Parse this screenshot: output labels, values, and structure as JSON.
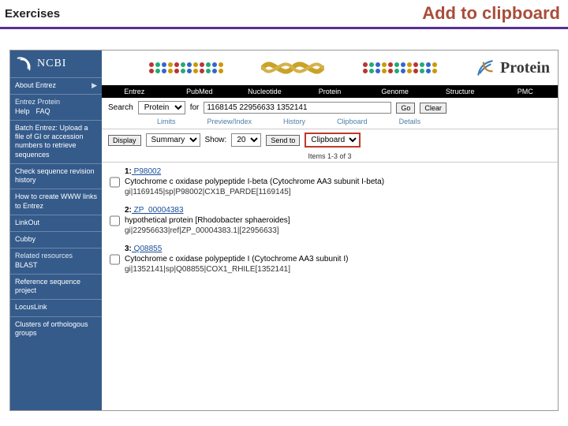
{
  "slide": {
    "left": "Exercises",
    "right": "Add to clipboard"
  },
  "sidebar": {
    "brand": "NCBI",
    "about": "About Entrez",
    "section_title": "Entrez Protein",
    "help": "Help",
    "faq": "FAQ",
    "batch": "Batch Entrez: Upload a file of GI or accession numbers to retrieve sequences",
    "revision": "Check sequence revision history",
    "howto": "How to create WWW links to Entrez",
    "linkout": "LinkOut",
    "cubby": "Cubby",
    "related": "Related resources",
    "blast": "BLAST",
    "ref": "Reference sequence project",
    "locuslink": "LocusLink",
    "cog": "Clusters of orthologous groups"
  },
  "tabs": [
    "Entrez",
    "PubMed",
    "Nucleotide",
    "Protein",
    "Genome",
    "Structure",
    "PMC"
  ],
  "search": {
    "label": "Search",
    "db": "Protein",
    "for": "for",
    "query": "1168145 22956633 1352141",
    "go": "Go",
    "clear": "Clear"
  },
  "sublinks": [
    "Limits",
    "Preview/Index",
    "History",
    "Clipboard",
    "Details"
  ],
  "display": {
    "label": "Display",
    "format": "Summary",
    "show_label": "Show:",
    "show": "20",
    "send": "Send to",
    "sendto": "Clipboard"
  },
  "items_text": "Items 1-3 of 3",
  "results": [
    {
      "n": "1:",
      "acc": "P98002",
      "title": "Cytochrome c oxidase polypeptide I-beta (Cytochrome AA3 subunit I-beta)",
      "gi": "gi|1169145|sp|P98002|CX1B_PARDE[1169145]"
    },
    {
      "n": "2:",
      "acc": "ZP_00004383",
      "title": "hypothetical protein [Rhodobacter sphaeroides]",
      "gi": "gi|22956633|ref|ZP_00004383.1|[22956633]"
    },
    {
      "n": "3:",
      "acc": "Q08855",
      "title": "Cytochrome c oxidase polypeptide I (Cytochrome AA3 subunit I)",
      "gi": "gi|1352141|sp|Q08855|COX1_RHILE[1352141]"
    }
  ],
  "banner": {
    "title": "Protein"
  },
  "bead_colors": [
    "#b33",
    "#2a7",
    "#36c",
    "#c90",
    "#b33",
    "#2a7",
    "#36c",
    "#c90",
    "#b33",
    "#2a7",
    "#36c",
    "#c90"
  ]
}
